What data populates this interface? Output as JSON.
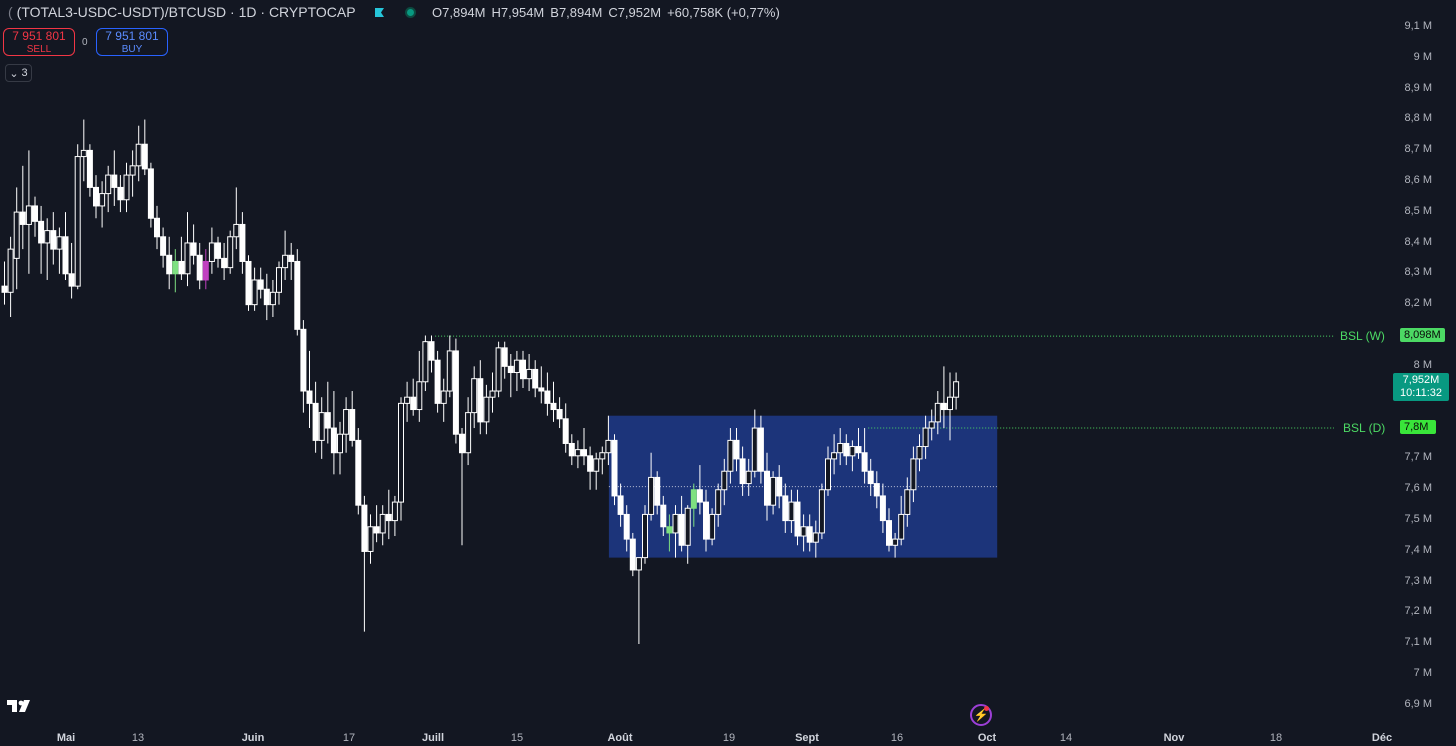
{
  "header": {
    "symbol": "(TOTAL3-USDC-USDT)/BTCUSD · 1D · CRYPTOCAP",
    "ohlc": [
      {
        "key": "O",
        "value": "7,894M"
      },
      {
        "key": "H",
        "value": "7,954M"
      },
      {
        "key": "B",
        "value": "7,894M"
      },
      {
        "key": "C",
        "value": "7,952M"
      }
    ],
    "change": "+60,758K (+0,77%)"
  },
  "trade": {
    "sell_price": "7 951 801",
    "sell_label": "SELL",
    "spread": "0",
    "buy_price": "7 951 801",
    "buy_label": "BUY"
  },
  "indicators": {
    "count": "3"
  },
  "y_axis": {
    "labels": [
      "9,1 M",
      "9 M",
      "8,9 M",
      "8,8 M",
      "8,7 M",
      "8,6 M",
      "8,5 M",
      "8,4 M",
      "8,3 M",
      "8,2 M",
      "8 M",
      "7,7 M",
      "7,6 M",
      "7,5 M",
      "7,4 M",
      "7,3 M",
      "7,2 M",
      "7,1 M",
      "7 M",
      "6,9 M"
    ]
  },
  "x_axis": {
    "labels": [
      {
        "text": "Mai",
        "bold": true
      },
      {
        "text": "13",
        "bold": false
      },
      {
        "text": "Juin",
        "bold": true
      },
      {
        "text": "17",
        "bold": false
      },
      {
        "text": "Juill",
        "bold": true
      },
      {
        "text": "15",
        "bold": false
      },
      {
        "text": "Août",
        "bold": true
      },
      {
        "text": "19",
        "bold": false
      },
      {
        "text": "Sept",
        "bold": true
      },
      {
        "text": "16",
        "bold": false
      },
      {
        "text": "Oct",
        "bold": true
      },
      {
        "text": "14",
        "bold": false
      },
      {
        "text": "Nov",
        "bold": true
      },
      {
        "text": "18",
        "bold": false
      },
      {
        "text": "Déc",
        "bold": true
      }
    ]
  },
  "levels": {
    "bsl_w_label": "BSL (W)",
    "bsl_w_value": "8,098M",
    "bsl_d_label": "BSL (D)",
    "bsl_d_value": "7,8M"
  },
  "last_price": {
    "value": "7,952M",
    "countdown": "10:11:32"
  },
  "colors": {
    "background": "#131722",
    "candle": "#ffffff",
    "zone": "#1e3a8a",
    "bsl": "#4cd964",
    "accent_green": "#089981",
    "highlight_green": "#7ee081",
    "highlight_magenta": "#c040c0"
  },
  "chart_data": {
    "type": "candlestick",
    "ylim": [
      6.88,
      9.12
    ],
    "candles": [
      [
        8.26,
        8.34,
        8.2,
        8.24
      ],
      [
        8.24,
        8.42,
        8.16,
        8.38
      ],
      [
        8.35,
        8.58,
        8.25,
        8.5
      ],
      [
        8.5,
        8.65,
        8.38,
        8.46
      ],
      [
        8.46,
        8.7,
        8.3,
        8.52
      ],
      [
        8.52,
        8.55,
        8.42,
        8.47
      ],
      [
        8.47,
        8.52,
        8.3,
        8.4
      ],
      [
        8.4,
        8.48,
        8.28,
        8.44
      ],
      [
        8.44,
        8.5,
        8.33,
        8.38
      ],
      [
        8.38,
        8.45,
        8.3,
        8.42
      ],
      [
        8.42,
        8.5,
        8.28,
        8.3
      ],
      [
        8.3,
        8.4,
        8.22,
        8.26
      ],
      [
        8.26,
        8.72,
        8.25,
        8.68
      ],
      [
        8.68,
        8.8,
        8.6,
        8.7
      ],
      [
        8.7,
        8.72,
        8.55,
        8.58
      ],
      [
        8.58,
        8.62,
        8.48,
        8.52
      ],
      [
        8.52,
        8.6,
        8.45,
        8.56
      ],
      [
        8.56,
        8.65,
        8.5,
        8.62
      ],
      [
        8.62,
        8.7,
        8.52,
        8.58
      ],
      [
        8.58,
        8.62,
        8.5,
        8.54
      ],
      [
        8.54,
        8.66,
        8.5,
        8.62
      ],
      [
        8.62,
        8.7,
        8.55,
        8.65
      ],
      [
        8.65,
        8.78,
        8.6,
        8.72
      ],
      [
        8.72,
        8.8,
        8.62,
        8.64
      ],
      [
        8.64,
        8.66,
        8.45,
        8.48
      ],
      [
        8.48,
        8.52,
        8.38,
        8.42
      ],
      [
        8.42,
        8.45,
        8.32,
        8.36
      ],
      [
        8.36,
        8.42,
        8.25,
        8.3
      ],
      [
        8.3,
        8.38,
        8.24,
        8.34
      ],
      [
        8.34,
        8.42,
        8.28,
        8.3
      ],
      [
        8.3,
        8.5,
        8.26,
        8.4
      ],
      [
        8.4,
        8.46,
        8.33,
        8.36
      ],
      [
        8.36,
        8.4,
        8.25,
        8.28
      ],
      [
        8.28,
        8.38,
        8.25,
        8.34
      ],
      [
        8.34,
        8.45,
        8.3,
        8.4
      ],
      [
        8.4,
        8.42,
        8.32,
        8.35
      ],
      [
        8.35,
        8.4,
        8.28,
        8.32
      ],
      [
        8.32,
        8.44,
        8.3,
        8.42
      ],
      [
        8.42,
        8.58,
        8.38,
        8.46
      ],
      [
        8.46,
        8.5,
        8.3,
        8.34
      ],
      [
        8.34,
        8.36,
        8.18,
        8.2
      ],
      [
        8.2,
        8.32,
        8.18,
        8.28
      ],
      [
        8.28,
        8.32,
        8.22,
        8.25
      ],
      [
        8.25,
        8.3,
        8.15,
        8.2
      ],
      [
        8.2,
        8.28,
        8.16,
        8.24
      ],
      [
        8.24,
        8.34,
        8.2,
        8.32
      ],
      [
        8.32,
        8.44,
        8.28,
        8.36
      ],
      [
        8.36,
        8.4,
        8.28,
        8.34
      ],
      [
        8.34,
        8.38,
        8.1,
        8.12
      ],
      [
        8.12,
        8.15,
        7.85,
        7.92
      ],
      [
        7.92,
        8.05,
        7.8,
        7.88
      ],
      [
        7.88,
        7.95,
        7.72,
        7.76
      ],
      [
        7.76,
        7.9,
        7.7,
        7.85
      ],
      [
        7.85,
        7.95,
        7.75,
        7.8
      ],
      [
        7.8,
        7.92,
        7.65,
        7.72
      ],
      [
        7.72,
        7.82,
        7.65,
        7.78
      ],
      [
        7.78,
        7.9,
        7.72,
        7.86
      ],
      [
        7.86,
        7.92,
        7.74,
        7.76
      ],
      [
        7.76,
        7.8,
        7.52,
        7.55
      ],
      [
        7.55,
        7.58,
        7.14,
        7.4
      ],
      [
        7.4,
        7.52,
        7.36,
        7.48
      ],
      [
        7.48,
        7.55,
        7.43,
        7.46
      ],
      [
        7.46,
        7.55,
        7.42,
        7.52
      ],
      [
        7.52,
        7.6,
        7.44,
        7.5
      ],
      [
        7.5,
        7.58,
        7.45,
        7.56
      ],
      [
        7.56,
        7.9,
        7.5,
        7.88
      ],
      [
        7.88,
        7.95,
        7.82,
        7.9
      ],
      [
        7.9,
        7.96,
        7.84,
        7.86
      ],
      [
        7.86,
        8.05,
        7.82,
        7.95
      ],
      [
        7.95,
        8.1,
        7.92,
        8.08
      ],
      [
        8.08,
        8.1,
        7.98,
        8.02
      ],
      [
        8.02,
        8.05,
        7.85,
        7.88
      ],
      [
        7.88,
        7.96,
        7.82,
        7.92
      ],
      [
        7.92,
        8.1,
        7.9,
        8.05
      ],
      [
        8.05,
        8.09,
        7.75,
        7.78
      ],
      [
        7.78,
        7.8,
        7.42,
        7.72
      ],
      [
        7.72,
        7.9,
        7.68,
        7.85
      ],
      [
        7.85,
        8.0,
        7.8,
        7.96
      ],
      [
        7.96,
        8.02,
        7.78,
        7.82
      ],
      [
        7.82,
        7.94,
        7.78,
        7.9
      ],
      [
        7.9,
        7.98,
        7.85,
        7.92
      ],
      [
        7.92,
        8.08,
        7.9,
        8.06
      ],
      [
        8.06,
        8.08,
        7.96,
        8.0
      ],
      [
        8.0,
        8.04,
        7.9,
        7.98
      ],
      [
        7.98,
        8.05,
        7.92,
        8.02
      ],
      [
        8.02,
        8.05,
        7.93,
        7.96
      ],
      [
        7.96,
        8.04,
        7.92,
        7.99
      ],
      [
        7.99,
        8.02,
        7.9,
        7.93
      ],
      [
        7.93,
        8.0,
        7.88,
        7.92
      ],
      [
        7.92,
        7.98,
        7.84,
        7.88
      ],
      [
        7.88,
        7.95,
        7.82,
        7.86
      ],
      [
        7.86,
        7.9,
        7.8,
        7.83
      ],
      [
        7.83,
        7.88,
        7.72,
        7.75
      ],
      [
        7.75,
        7.78,
        7.68,
        7.71
      ],
      [
        7.71,
        7.76,
        7.67,
        7.73
      ],
      [
        7.73,
        7.8,
        7.68,
        7.71
      ],
      [
        7.71,
        7.74,
        7.6,
        7.66
      ],
      [
        7.66,
        7.72,
        7.6,
        7.7
      ],
      [
        7.7,
        7.74,
        7.65,
        7.72
      ],
      [
        7.72,
        7.84,
        7.68,
        7.76
      ],
      [
        7.76,
        7.78,
        7.55,
        7.58
      ],
      [
        7.58,
        7.62,
        7.48,
        7.52
      ],
      [
        7.52,
        7.55,
        7.4,
        7.44
      ],
      [
        7.44,
        7.46,
        7.32,
        7.34
      ],
      [
        7.34,
        7.36,
        7.1,
        7.38
      ],
      [
        7.38,
        7.55,
        7.36,
        7.52
      ],
      [
        7.52,
        7.72,
        7.5,
        7.64
      ],
      [
        7.64,
        7.66,
        7.52,
        7.55
      ],
      [
        7.55,
        7.58,
        7.45,
        7.48
      ],
      [
        7.48,
        7.52,
        7.4,
        7.46
      ],
      [
        7.46,
        7.55,
        7.38,
        7.52
      ],
      [
        7.52,
        7.58,
        7.4,
        7.42
      ],
      [
        7.42,
        7.55,
        7.36,
        7.54
      ],
      [
        7.54,
        7.62,
        7.48,
        7.6
      ],
      [
        7.6,
        7.68,
        7.52,
        7.56
      ],
      [
        7.56,
        7.6,
        7.4,
        7.44
      ],
      [
        7.44,
        7.54,
        7.42,
        7.52
      ],
      [
        7.52,
        7.62,
        7.48,
        7.6
      ],
      [
        7.6,
        7.7,
        7.55,
        7.66
      ],
      [
        7.66,
        7.8,
        7.62,
        7.76
      ],
      [
        7.76,
        7.8,
        7.66,
        7.7
      ],
      [
        7.7,
        7.74,
        7.58,
        7.62
      ],
      [
        7.62,
        7.7,
        7.58,
        7.66
      ],
      [
        7.66,
        7.86,
        7.64,
        7.8
      ],
      [
        7.8,
        7.84,
        7.62,
        7.66
      ],
      [
        7.66,
        7.72,
        7.5,
        7.55
      ],
      [
        7.55,
        7.66,
        7.52,
        7.64
      ],
      [
        7.64,
        7.68,
        7.54,
        7.58
      ],
      [
        7.58,
        7.62,
        7.46,
        7.5
      ],
      [
        7.5,
        7.6,
        7.46,
        7.56
      ],
      [
        7.56,
        7.6,
        7.42,
        7.45
      ],
      [
        7.45,
        7.52,
        7.4,
        7.48
      ],
      [
        7.48,
        7.52,
        7.4,
        7.43
      ],
      [
        7.43,
        7.5,
        7.38,
        7.46
      ],
      [
        7.46,
        7.62,
        7.44,
        7.6
      ],
      [
        7.6,
        7.74,
        7.58,
        7.7
      ],
      [
        7.7,
        7.78,
        7.65,
        7.72
      ],
      [
        7.72,
        7.8,
        7.68,
        7.75
      ],
      [
        7.75,
        7.78,
        7.68,
        7.71
      ],
      [
        7.71,
        7.76,
        7.66,
        7.74
      ],
      [
        7.74,
        7.8,
        7.7,
        7.72
      ],
      [
        7.72,
        7.8,
        7.62,
        7.66
      ],
      [
        7.66,
        7.7,
        7.58,
        7.62
      ],
      [
        7.62,
        7.66,
        7.54,
        7.58
      ],
      [
        7.58,
        7.62,
        7.46,
        7.5
      ],
      [
        7.5,
        7.54,
        7.4,
        7.42
      ],
      [
        7.42,
        7.46,
        7.38,
        7.44
      ],
      [
        7.44,
        7.58,
        7.42,
        7.52
      ],
      [
        7.52,
        7.64,
        7.48,
        7.6
      ],
      [
        7.6,
        7.74,
        7.56,
        7.7
      ],
      [
        7.7,
        7.78,
        7.66,
        7.74
      ],
      [
        7.74,
        7.84,
        7.7,
        7.8
      ],
      [
        7.8,
        7.86,
        7.76,
        7.82
      ],
      [
        7.82,
        7.92,
        7.78,
        7.88
      ],
      [
        7.88,
        8.0,
        7.8,
        7.86
      ],
      [
        7.86,
        7.98,
        7.76,
        7.9
      ],
      [
        7.9,
        7.98,
        7.86,
        7.95
      ]
    ],
    "highlighted": {
      "green": [
        28,
        109,
        113
      ],
      "magenta": [
        33
      ]
    },
    "zone": {
      "x_start_index": 99,
      "x_end_index": 162,
      "y_low": 7.38,
      "y_high": 7.84
    },
    "bsl_w": {
      "y": 8.098,
      "x_start_index": 71
    },
    "bsl_d": {
      "y": 7.8,
      "x_start_index": 142
    },
    "midline": {
      "y": 7.61
    }
  }
}
